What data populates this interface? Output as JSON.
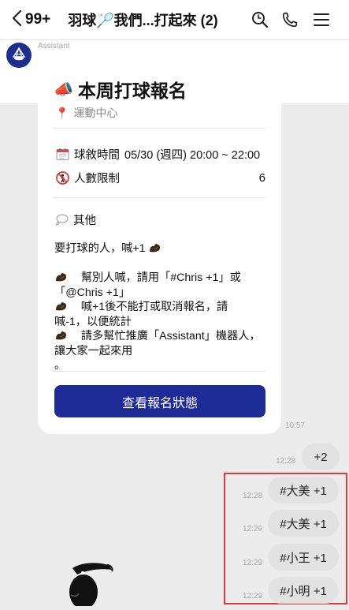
{
  "header": {
    "back_count": "99+",
    "title": "羽球🏸我們...打起來 (2)",
    "icons": [
      "back-chevron-icon",
      "search-icon",
      "phone-icon",
      "menu-icon"
    ]
  },
  "sender": {
    "name": "Assistant"
  },
  "card": {
    "title_emoji": "📣",
    "title": "本周打球報名",
    "location_emoji": "📍",
    "location": "運動中心",
    "time_label": "球敘時間",
    "time_value": "05/30 (週四) 20:00 ~ 22:00",
    "limit_label": "人數限制",
    "limit_value": "6",
    "other_label": "其他",
    "line1": "要打球的人，喊+1",
    "line2a": "幫別人喊，請用「#Chris +1」或",
    "line2b": "「@Chris +1」",
    "line3a": "喊+1後不能打或取消報名，請",
    "line3b": "喊-1，以便統計",
    "line4a": "請多幫忙推廣「Assistant」機器人，",
    "line4b": "讓大家一起來用",
    "line4c": "。",
    "button_label": "查看報名狀態",
    "time": "10:57"
  },
  "messages": [
    {
      "time": "12:28",
      "text": "+2"
    },
    {
      "time": "12:28",
      "text": "#大美 +1"
    },
    {
      "time": "12:29",
      "text": "#大美 +1"
    },
    {
      "time": "12:29",
      "text": "#小王 +1"
    },
    {
      "time": "12:29",
      "text": "#小明 +1"
    }
  ],
  "colors": {
    "accent_button": "#1e2a96",
    "highlight_box": "#e53939",
    "chat_background": "#ececec",
    "bubble": "#e2e2e2"
  }
}
